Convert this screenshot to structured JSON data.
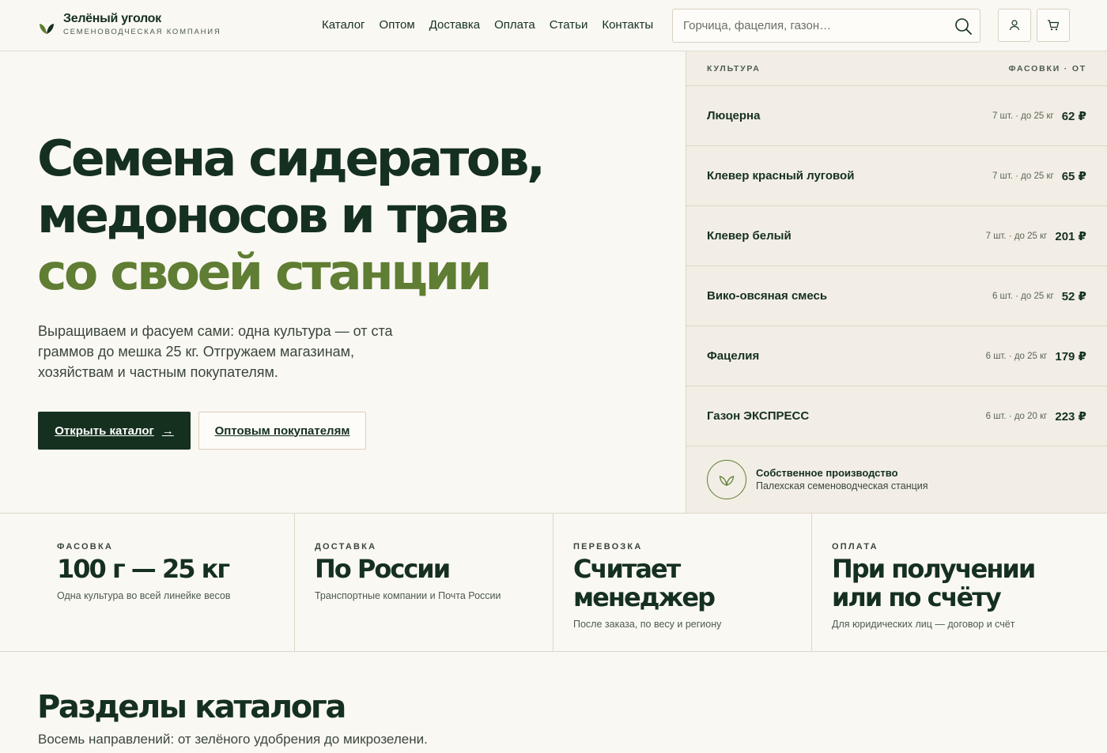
{
  "header": {
    "logo_title": "Зелёный уголок",
    "logo_subtitle": "Семеноводческая компания",
    "nav": [
      "Каталог",
      "Оптом",
      "Доставка",
      "Оплата",
      "Статьи",
      "Контакты"
    ],
    "search_placeholder": "Горчица, фацелия, газон…",
    "icons": [
      "search-icon",
      "user-icon",
      "cart-icon"
    ]
  },
  "hero": {
    "title_line1": "Семена сидератов,",
    "title_line2": "медоносов и трав",
    "title_line3": "со своей станции",
    "lead": "Выращиваем и фасуем сами: одна культура — от ста граммов до мешка 25 кг. Отгружаем магазинам, хозяйствам и частным покупателям.",
    "primary_button": "Открыть каталог",
    "primary_arrow": "→",
    "secondary_button": "Оптовым покупателям"
  },
  "prices": {
    "col_culture": "Культура",
    "col_packs": "Фасовки · от",
    "rows": [
      {
        "name": "Люцерна",
        "packs": "7 шт. · до 25 кг",
        "price": "62 ₽"
      },
      {
        "name": "Клевер красный луговой",
        "packs": "7 шт. · до 25 кг",
        "price": "65 ₽"
      },
      {
        "name": "Клевер белый",
        "packs": "7 шт. · до 25 кг",
        "price": "201 ₽"
      },
      {
        "name": "Вико-овсяная смесь",
        "packs": "6 шт. · до 25 кг",
        "price": "52 ₽"
      },
      {
        "name": "Фацелия",
        "packs": "6 шт. · до 25 кг",
        "price": "179 ₽"
      },
      {
        "name": "Газон ЭКСПРЕСС",
        "packs": "6 шт. · до 20 кг",
        "price": "223 ₽"
      }
    ],
    "production_title": "Собственное производство",
    "production_subtitle": "Палехская семеноводческая станция"
  },
  "features": [
    {
      "label": "Фасовка",
      "value": "100 г — 25 кг",
      "note": "Одна культура во всей линейке весов"
    },
    {
      "label": "Доставка",
      "value": "По России",
      "note": "Транспортные компании и Почта России"
    },
    {
      "label": "Перевозка",
      "value": "Считает менеджер",
      "note": "После заказа, по весу и региону"
    },
    {
      "label": "Оплата",
      "value": "При получении или по счёту",
      "note": "Для юридических лиц — договор и счёт"
    }
  ],
  "catalog": {
    "title": "Разделы каталога",
    "lead": "Восемь направлений: от зелёного удобрения до микрозелени."
  },
  "colors": {
    "brand_dark": "#15301f",
    "brand_accent": "#5f7d33",
    "background": "#faf8f3",
    "panel": "#f2eee5"
  }
}
